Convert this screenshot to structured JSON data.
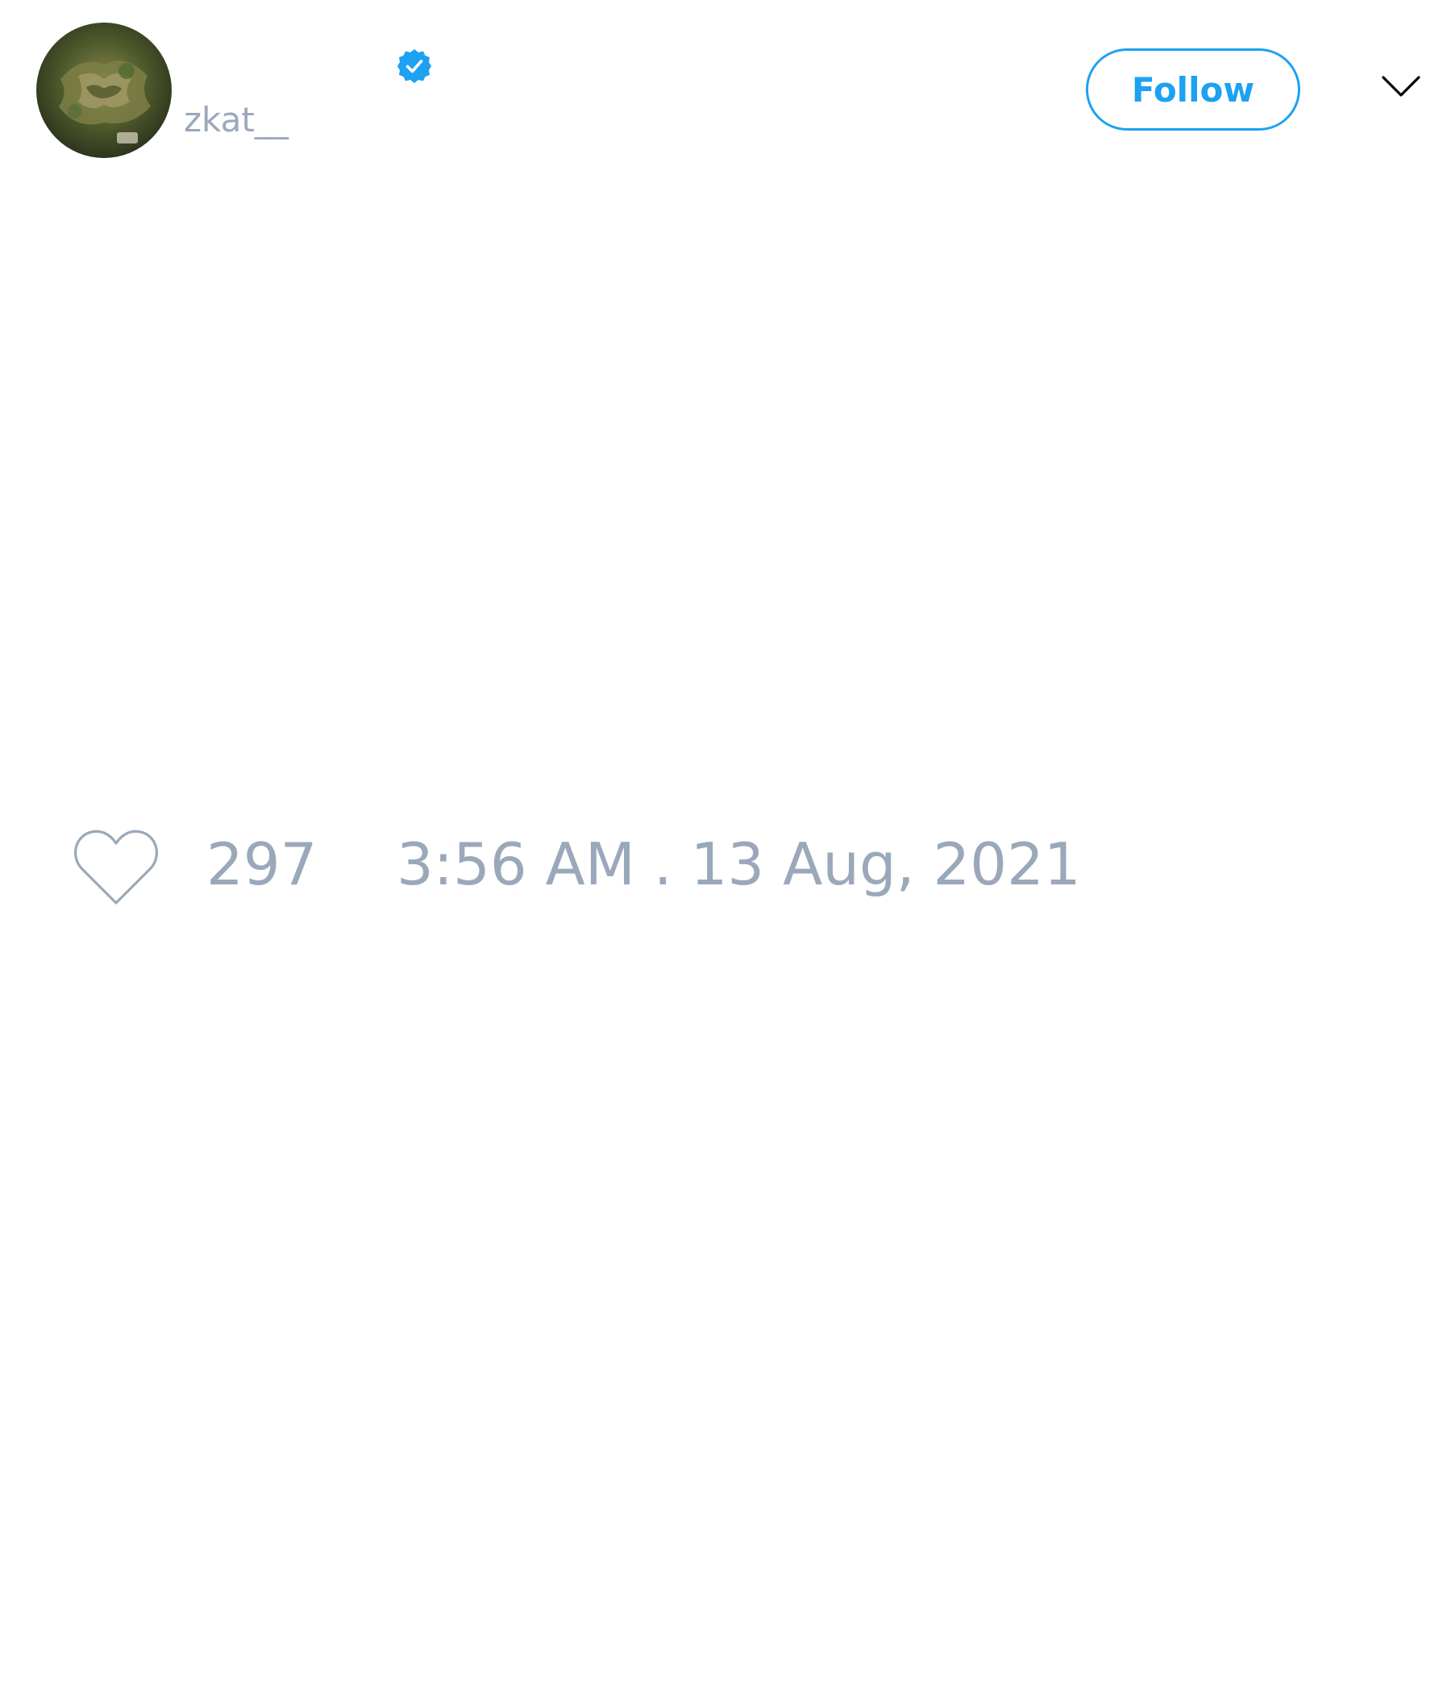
{
  "user": {
    "display_name": "",
    "handle": "zkat__",
    "verified": true,
    "avatar": "avatar-image"
  },
  "actions": {
    "follow_label": "Follow",
    "menu_icon": "chevron-down-icon"
  },
  "tweet": {
    "like_icon": "heart-icon",
    "like_count": "297",
    "timestamp": "3:56 AM . 13 Aug, 2021"
  },
  "colors": {
    "accent": "#1da1f2",
    "muted_text": "#9aa8ba",
    "background": "#ffffff"
  }
}
